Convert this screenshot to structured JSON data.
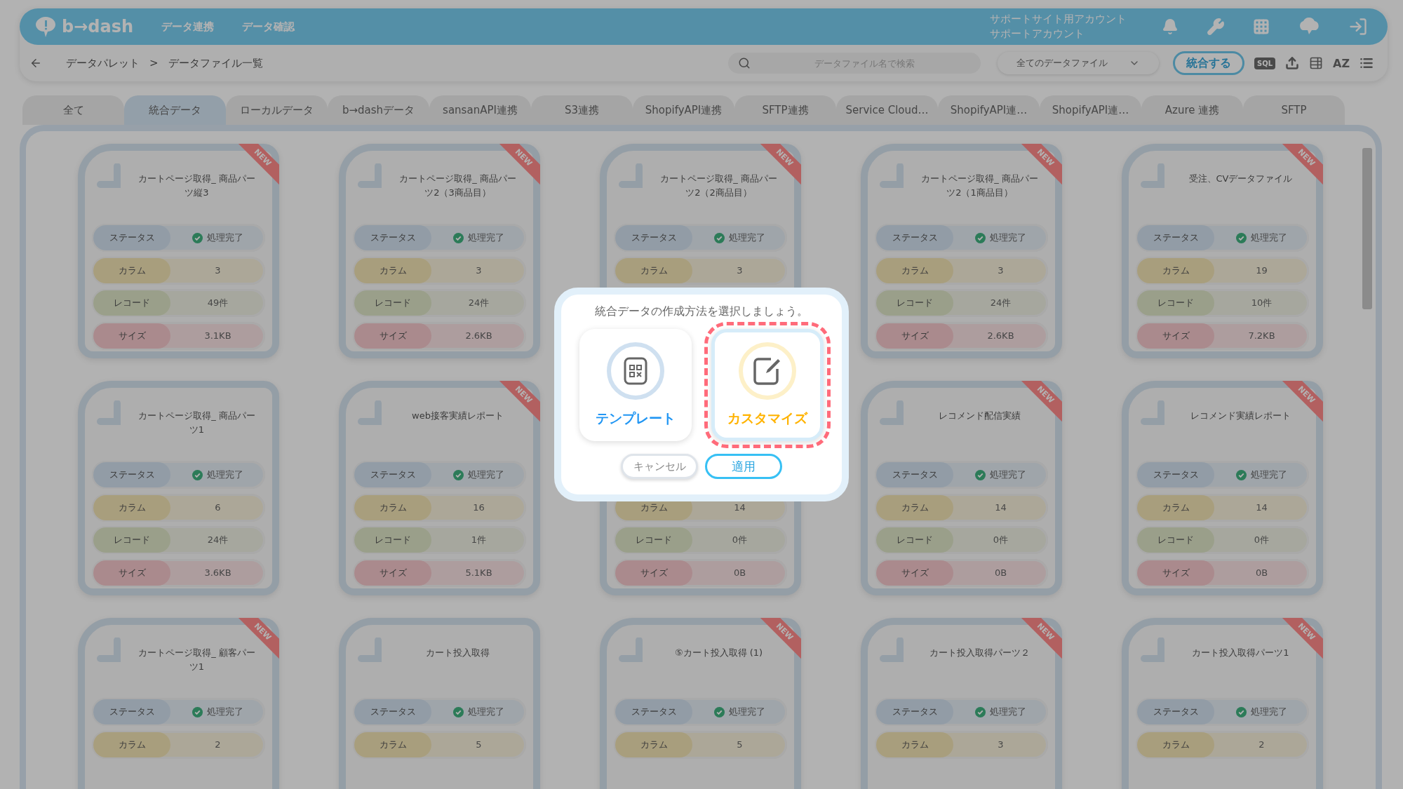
{
  "header": {
    "logo": "b→dash",
    "nav": [
      {
        "label": "データ連携"
      },
      {
        "label": "データ確認"
      }
    ],
    "account": [
      "サポートサイト用アカウント",
      "サポートアカウント"
    ]
  },
  "breadcrumb": {
    "items": [
      "データパレット",
      "データファイル一覧"
    ],
    "separator": ">"
  },
  "toolbar": {
    "search": {
      "placeholder": "データファイル名で検索"
    },
    "filter": {
      "value": "全てのデータファイル"
    },
    "merge_button": "統合する",
    "sql_label": "SQL",
    "sort_label": "AZ"
  },
  "tabs": [
    {
      "label": "全て",
      "selected": false
    },
    {
      "label": "統合データ",
      "selected": true
    },
    {
      "label": "ローカルデータ",
      "selected": false
    },
    {
      "label": "b→dashデータ",
      "selected": false
    },
    {
      "label": "sansanAPI連携",
      "selected": false
    },
    {
      "label": "S3連携",
      "selected": false
    },
    {
      "label": "ShopifyAPI連携",
      "selected": false
    },
    {
      "label": "SFTP連携",
      "selected": false
    },
    {
      "label": "Service Cloud…",
      "selected": false
    },
    {
      "label": "ShopifyAPI連…",
      "selected": false
    },
    {
      "label": "ShopifyAPI連…",
      "selected": false
    },
    {
      "label": "Azure 連携",
      "selected": false
    },
    {
      "label": "SFTP",
      "selected": false
    }
  ],
  "cards": [
    {
      "title": "カートページ取得_ 商品パーツ縦3",
      "badge": "NEW",
      "rows": [
        {
          "kind": "status",
          "label": "ステータス",
          "value": "処理完了"
        },
        {
          "kind": "columns",
          "label": "カラム",
          "value": "3"
        },
        {
          "kind": "records",
          "label": "レコード",
          "value": "49件"
        },
        {
          "kind": "size",
          "label": "サイズ",
          "value": "3.1KB"
        }
      ]
    },
    {
      "title": "カートページ取得_ 商品パーツ2（3商品目）",
      "badge": "NEW",
      "rows": [
        {
          "kind": "status",
          "label": "ステータス",
          "value": "処理完了"
        },
        {
          "kind": "columns",
          "label": "カラム",
          "value": "3"
        },
        {
          "kind": "records",
          "label": "レコード",
          "value": "24件"
        },
        {
          "kind": "size",
          "label": "サイズ",
          "value": "2.6KB"
        }
      ]
    },
    {
      "title": "カートページ取得_ 商品パーツ2（2商品目）",
      "badge": "NEW",
      "rows": [
        {
          "kind": "status",
          "label": "ステータス",
          "value": "処理完了"
        },
        {
          "kind": "columns",
          "label": "カラム",
          "value": "3"
        }
      ]
    },
    {
      "title": "カートページ取得_ 商品パーツ2（1商品目）",
      "badge": "NEW",
      "rows": [
        {
          "kind": "status",
          "label": "ステータス",
          "value": "処理完了"
        },
        {
          "kind": "columns",
          "label": "カラム",
          "value": "3"
        },
        {
          "kind": "records",
          "label": "レコード",
          "value": "24件"
        },
        {
          "kind": "size",
          "label": "サイズ",
          "value": "2.6KB"
        }
      ]
    },
    {
      "title": "受注、CVデータファイル",
      "badge": "NEW",
      "rows": [
        {
          "kind": "status",
          "label": "ステータス",
          "value": "処理完了"
        },
        {
          "kind": "columns",
          "label": "カラム",
          "value": "19"
        },
        {
          "kind": "records",
          "label": "レコード",
          "value": "10件"
        },
        {
          "kind": "size",
          "label": "サイズ",
          "value": "7.2KB"
        }
      ]
    },
    {
      "title": "カートページ取得_ 商品パーツ1",
      "rows": [
        {
          "kind": "status",
          "label": "ステータス",
          "value": "処理完了"
        },
        {
          "kind": "columns",
          "label": "カラム",
          "value": "6"
        },
        {
          "kind": "records",
          "label": "レコード",
          "value": "24件"
        },
        {
          "kind": "size",
          "label": "サイズ",
          "value": "3.6KB"
        }
      ]
    },
    {
      "title": "web接客実績レポート",
      "badge": "NEW",
      "rows": [
        {
          "kind": "status",
          "label": "ステータス",
          "value": "処理完了"
        },
        {
          "kind": "columns",
          "label": "カラム",
          "value": "16"
        },
        {
          "kind": "records",
          "label": "レコード",
          "value": "1件"
        },
        {
          "kind": "size",
          "label": "サイズ",
          "value": "5.1KB"
        }
      ]
    },
    {
      "rows": [
        {
          "kind": "columns",
          "label": "カラム",
          "value": "14"
        },
        {
          "kind": "records",
          "label": "レコード",
          "value": "0件"
        },
        {
          "kind": "size",
          "label": "サイズ",
          "value": "0B"
        }
      ]
    },
    {
      "title": "レコメンド配信実績",
      "badge": "NEW",
      "rows": [
        {
          "kind": "status",
          "label": "ステータス",
          "value": "処理完了"
        },
        {
          "kind": "columns",
          "label": "カラム",
          "value": "14"
        },
        {
          "kind": "records",
          "label": "レコード",
          "value": "0件"
        },
        {
          "kind": "size",
          "label": "サイズ",
          "value": "0B"
        }
      ]
    },
    {
      "title": "レコメンド実績レポート",
      "badge": "NEW",
      "rows": [
        {
          "kind": "status",
          "label": "ステータス",
          "value": "処理完了"
        },
        {
          "kind": "columns",
          "label": "カラム",
          "value": "14"
        },
        {
          "kind": "records",
          "label": "レコード",
          "value": "0件"
        },
        {
          "kind": "size",
          "label": "サイズ",
          "value": "0B"
        }
      ]
    },
    {
      "title": "カートページ取得_ 顧客パーツ1",
      "badge": "NEW",
      "rows": [
        {
          "kind": "status",
          "label": "ステータス",
          "value": "処理完了"
        },
        {
          "kind": "columns",
          "label": "カラム",
          "value": "2"
        }
      ]
    },
    {
      "title": "カート投入取得",
      "rows": [
        {
          "kind": "status",
          "label": "ステータス",
          "value": "処理完了"
        },
        {
          "kind": "columns",
          "label": "カラム",
          "value": "5"
        }
      ]
    },
    {
      "title": "⑤カート投入取得 (1)",
      "badge": "NEW",
      "rows": [
        {
          "kind": "status",
          "label": "ステータス",
          "value": "処理完了"
        },
        {
          "kind": "columns",
          "label": "カラム",
          "value": "5"
        }
      ]
    },
    {
      "title": "カート投入取得パーツ２",
      "badge": "NEW",
      "rows": [
        {
          "kind": "status",
          "label": "ステータス",
          "value": "処理完了"
        },
        {
          "kind": "columns",
          "label": "カラム",
          "value": "3"
        }
      ]
    },
    {
      "title": "カート投入取得パーツ1",
      "badge": "NEW",
      "rows": [
        {
          "kind": "status",
          "label": "ステータス",
          "value": "処理完了"
        },
        {
          "kind": "columns",
          "label": "カラム",
          "value": "2"
        }
      ]
    }
  ],
  "modal": {
    "prompt": "統合データの作成方法を選択しましょう。",
    "options": [
      {
        "kind": "template",
        "label": "テンプレート",
        "selected": false
      },
      {
        "kind": "customize",
        "label": "カスタマイズ",
        "selected": true
      }
    ],
    "buttons": [
      {
        "kind": "cancel",
        "label": "キャンセル"
      },
      {
        "kind": "apply",
        "label": "適用"
      }
    ]
  }
}
